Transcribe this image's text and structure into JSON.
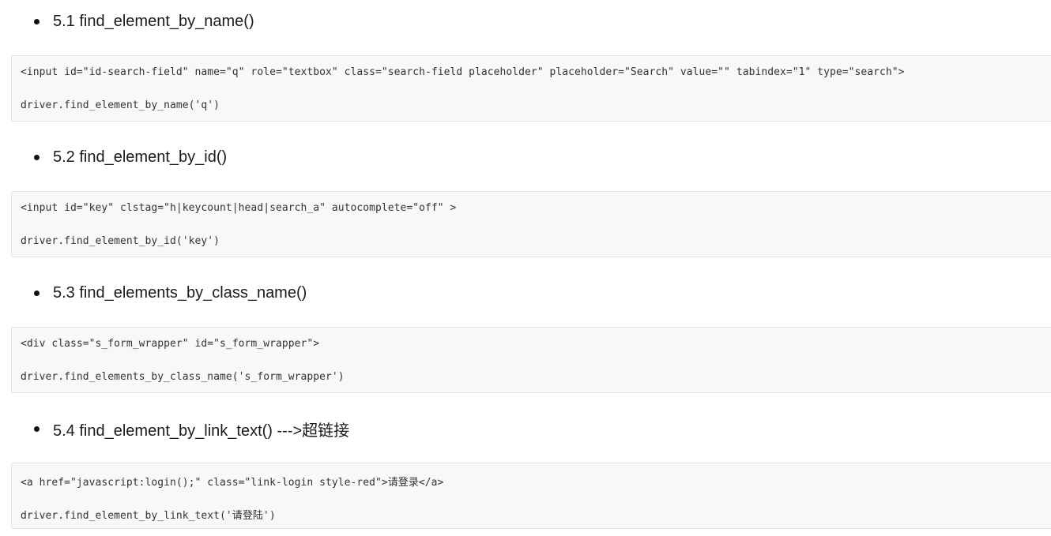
{
  "sections": [
    {
      "heading": "5.1 find_element_by_name()",
      "html_snippet": "<input id=\"id-search-field\" name=\"q\" role=\"textbox\" class=\"search-field placeholder\" placeholder=\"Search\" value=\"\" tabindex=\"1\" type=\"search\">",
      "code": "driver.find_element_by_name('q')"
    },
    {
      "heading": "5.2 find_element_by_id()",
      "html_snippet": "<input id=\"key\" clstag=\"h|keycount|head|search_a\" autocomplete=\"off\" >",
      "code": "driver.find_element_by_id('key')"
    },
    {
      "heading": "5.3 find_elements_by_class_name()",
      "html_snippet": "<div class=\"s_form_wrapper\" id=\"s_form_wrapper\">",
      "code": "driver.find_elements_by_class_name('s_form_wrapper')"
    },
    {
      "heading": "5.4 find_element_by_link_text() --->超链接",
      "html_snippet": "<a href=\"javascript:login();\" class=\"link-login style-red\">请登录</a>",
      "code": "driver.find_element_by_link_text('请登陆')"
    }
  ]
}
